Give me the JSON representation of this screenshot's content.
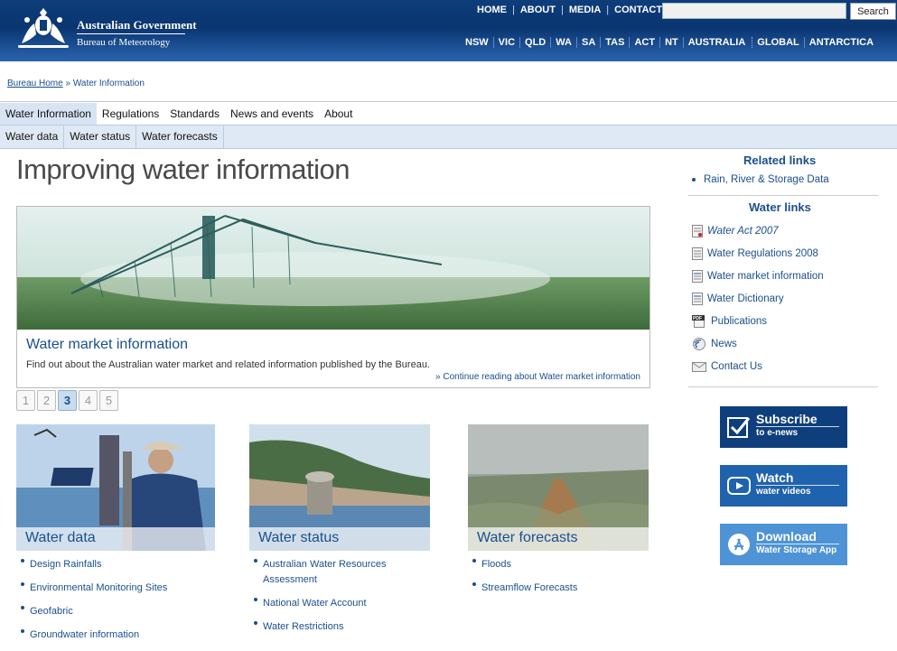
{
  "header": {
    "gov_name": "Australian Government",
    "bureau_name": "Bureau of Meteorology",
    "top_links": [
      "HOME",
      "ABOUT",
      "MEDIA",
      "CONTACTS"
    ],
    "search_button": "Search",
    "search_placeholder": "",
    "state_links": [
      "NSW",
      "VIC",
      "QLD",
      "WA",
      "SA",
      "TAS",
      "ACT",
      "NT",
      "AUSTRALIA",
      "GLOBAL",
      "ANTARCTICA"
    ]
  },
  "breadcrumb": {
    "home": "Bureau Home",
    "sep": "»",
    "current": "Water Information"
  },
  "main_nav": [
    "Water Information",
    "Regulations",
    "Standards",
    "News and events",
    "About"
  ],
  "sub_nav": [
    "Water data",
    "Water status",
    "Water forecasts"
  ],
  "page_title": "Improving water information",
  "feature": {
    "title": "Water market information",
    "description": "Find out about the Australian water market and related information published by the Bureau.",
    "more_link": "» Continue reading about Water market information"
  },
  "pager": [
    "1",
    "2",
    "3",
    "4",
    "5"
  ],
  "pager_current": "3",
  "cards": [
    {
      "title": "Water data",
      "links": [
        "Design Rainfalls",
        "Environmental Monitoring Sites",
        "Geofabric",
        "Groundwater information"
      ]
    },
    {
      "title": "Water status",
      "links": [
        "Australian Water Resources Assessment",
        "National Water Account",
        "Water Restrictions"
      ]
    },
    {
      "title": "Water forecasts",
      "links": [
        "Floods",
        "Streamflow Forecasts"
      ]
    }
  ],
  "right": {
    "related_heading": "Related links",
    "related_links": [
      "Rain, River & Storage Data"
    ],
    "water_heading": "Water links",
    "water_links": [
      "Water Act 2007",
      "Water Regulations 2008",
      "Water market information",
      "Water Dictionary",
      "Publications",
      "News",
      "Contact Us"
    ],
    "pdf_label": "PDF"
  },
  "promos": [
    {
      "title": "Subscribe",
      "subtitle": "to e-news",
      "color": "#0e3f7c"
    },
    {
      "title": "Watch",
      "subtitle": "water videos",
      "color": "#1f62ad"
    },
    {
      "title": "Download",
      "subtitle": "Water Storage App",
      "color": "#4e93d6"
    }
  ],
  "colors": {
    "header_blue": "#0d3d7a",
    "link_blue": "#1a4f8f",
    "subnav_bg": "#dfe9f5"
  }
}
